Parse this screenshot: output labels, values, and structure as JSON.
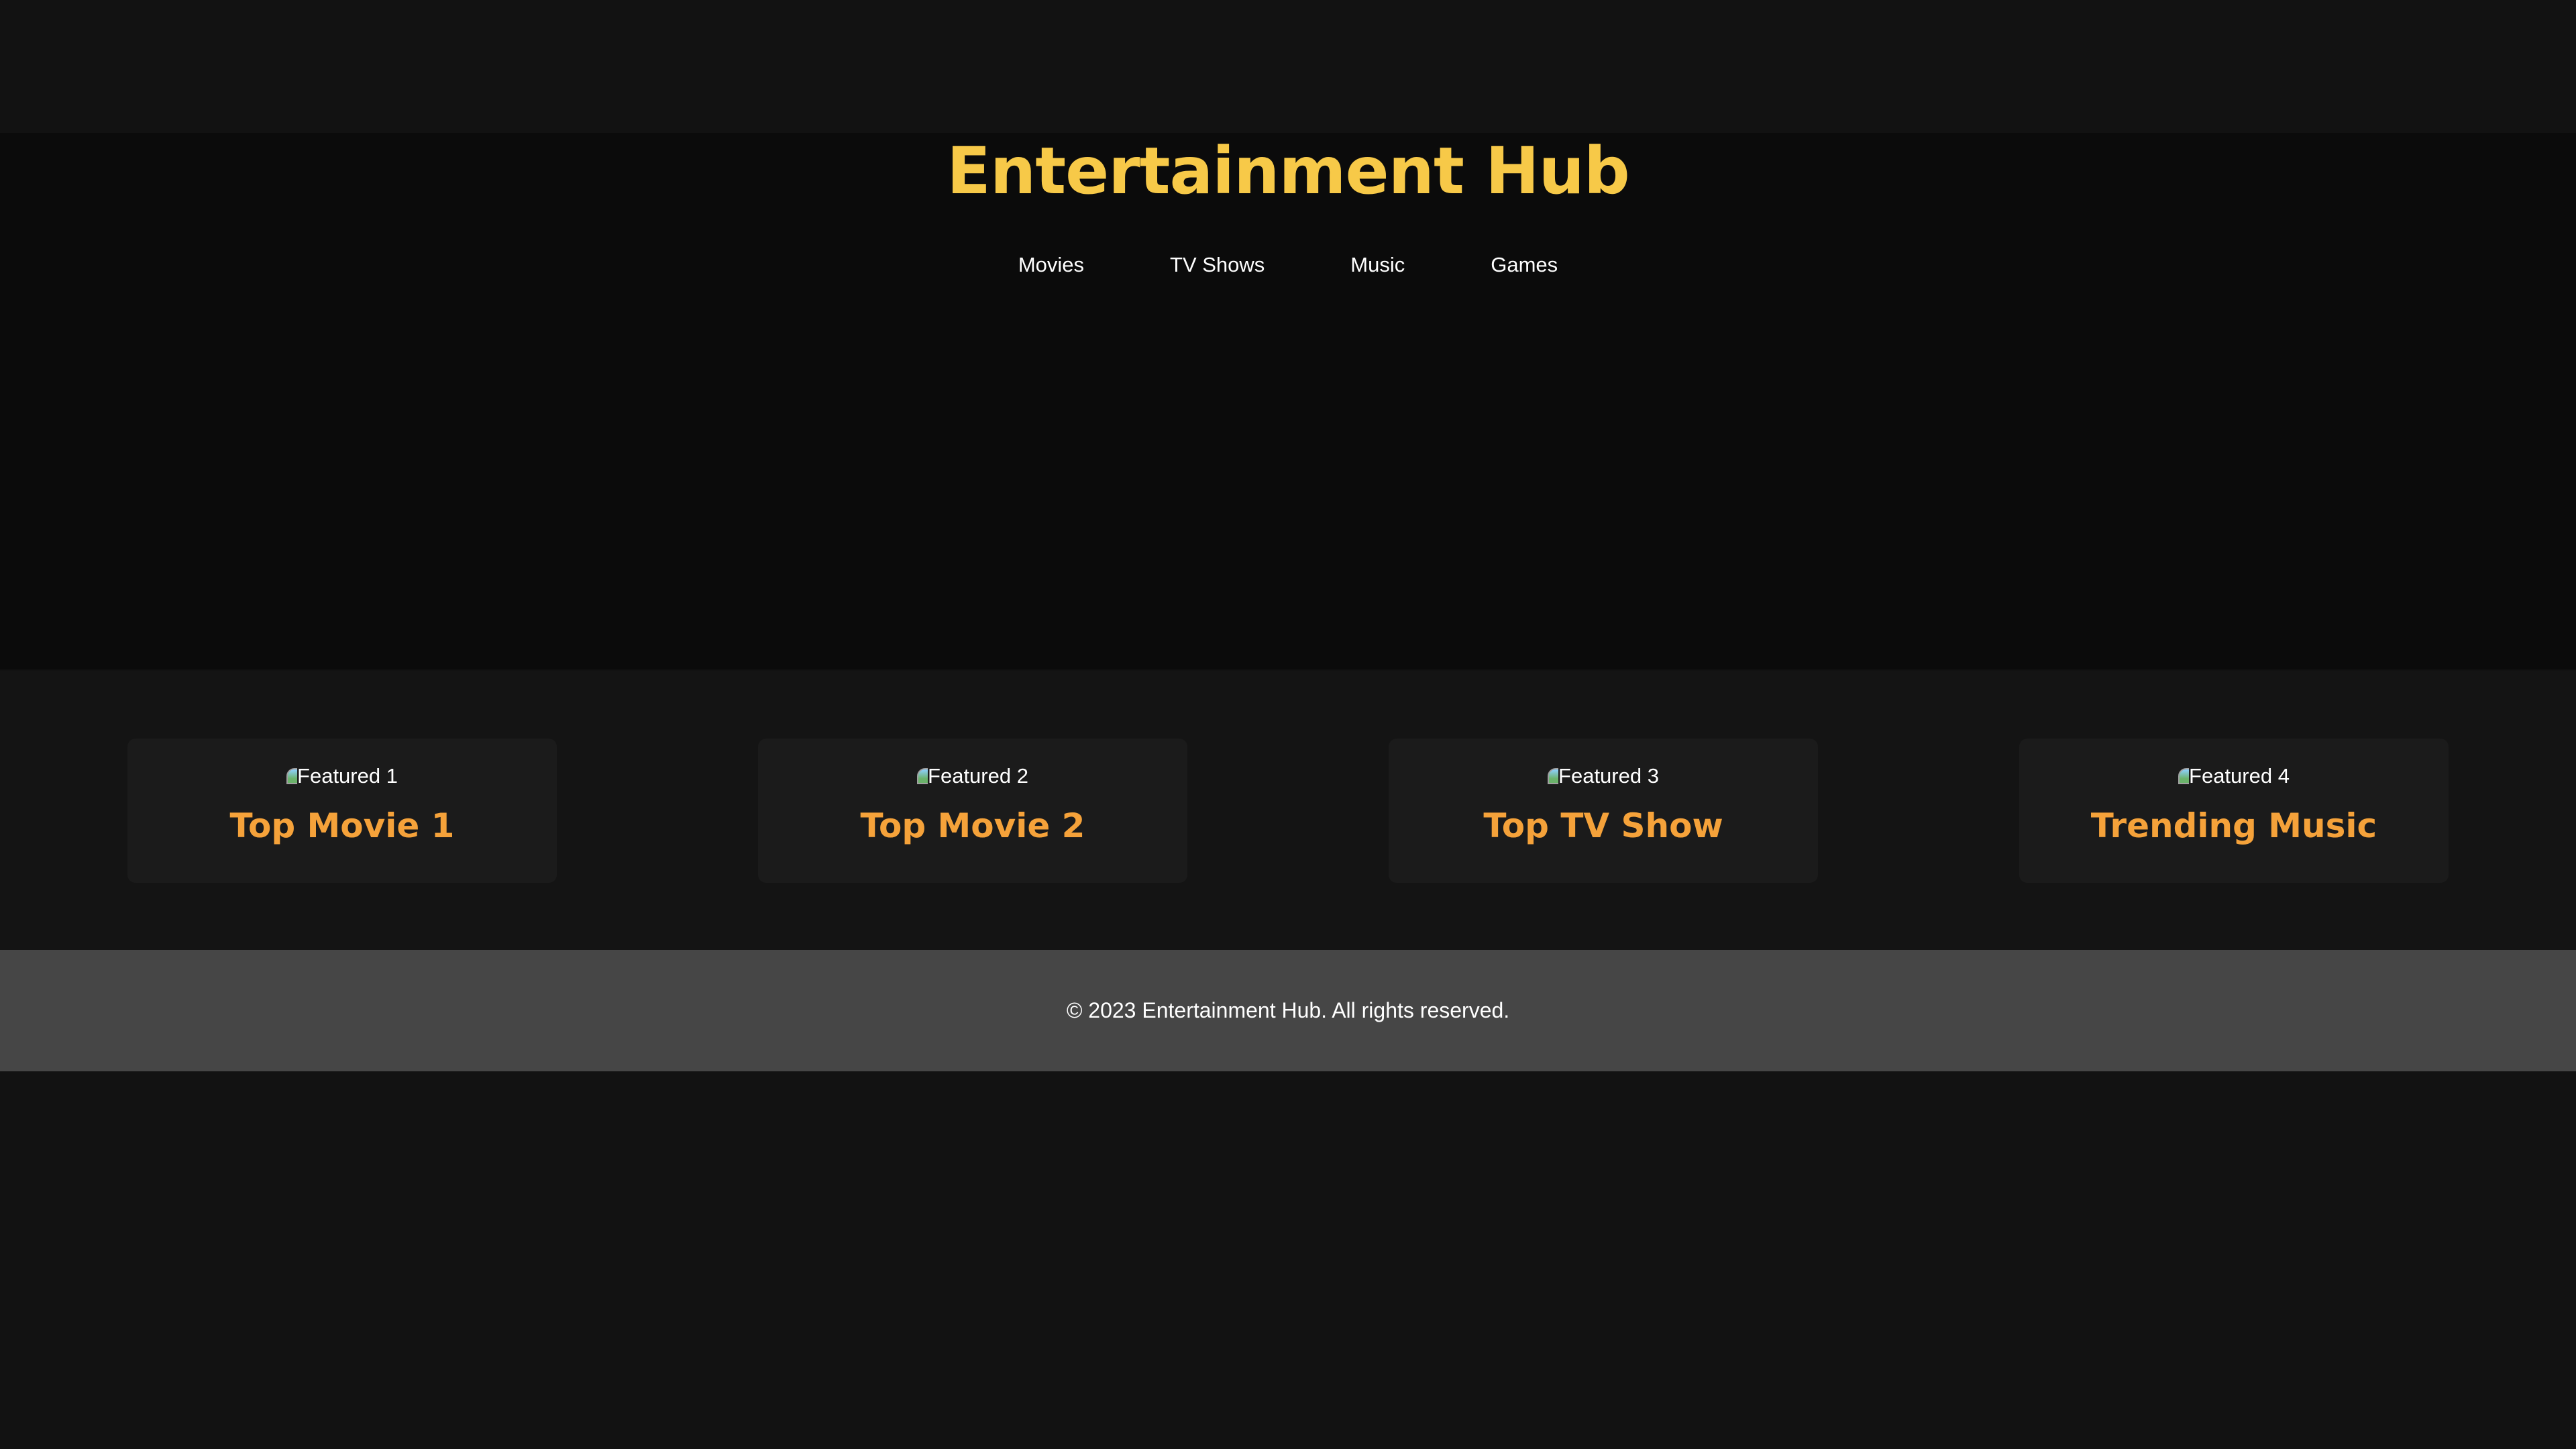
{
  "header": {
    "title": "Entertainment Hub",
    "nav": [
      {
        "label": "Movies"
      },
      {
        "label": "TV Shows"
      },
      {
        "label": "Music"
      },
      {
        "label": "Games"
      }
    ]
  },
  "featured": {
    "cards": [
      {
        "image_alt": "Featured 1",
        "title": "Top Movie 1"
      },
      {
        "image_alt": "Featured 2",
        "title": "Top Movie 2"
      },
      {
        "image_alt": "Featured 3",
        "title": "Top TV Show"
      },
      {
        "image_alt": "Featured 4",
        "title": "Trending Music"
      }
    ]
  },
  "footer": {
    "text": "© 2023 Entertainment Hub. All rights reserved."
  },
  "colors": {
    "background": "#121212",
    "title": "#f7c948",
    "card_title": "#f5a23a",
    "card_background": "#1b1b1b",
    "footer_background": "#464646"
  }
}
